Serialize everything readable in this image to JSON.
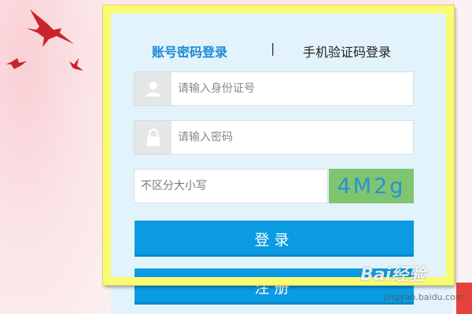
{
  "tabs": {
    "account_login": "账号密码登录",
    "divider": "|",
    "sms_login": "手机验证码登录"
  },
  "form": {
    "id_placeholder": "请输入身份证号",
    "password_placeholder": "请输入密码",
    "captcha_placeholder": "不区分大小写",
    "captcha_code": "4M2g"
  },
  "buttons": {
    "login": "登录",
    "register": "注册"
  },
  "icons": {
    "id_field": "user-icon",
    "password_field": "lock-icon"
  },
  "watermark": {
    "brand": "Bai经验",
    "site": "jingyan.baidu.com"
  },
  "colors": {
    "accent": "#0b9be3",
    "active_tab": "#1a8ad6",
    "highlight": "#fbfb73",
    "captcha_bg": "#7fc46f",
    "panel_bg": "#e2f3fb"
  }
}
